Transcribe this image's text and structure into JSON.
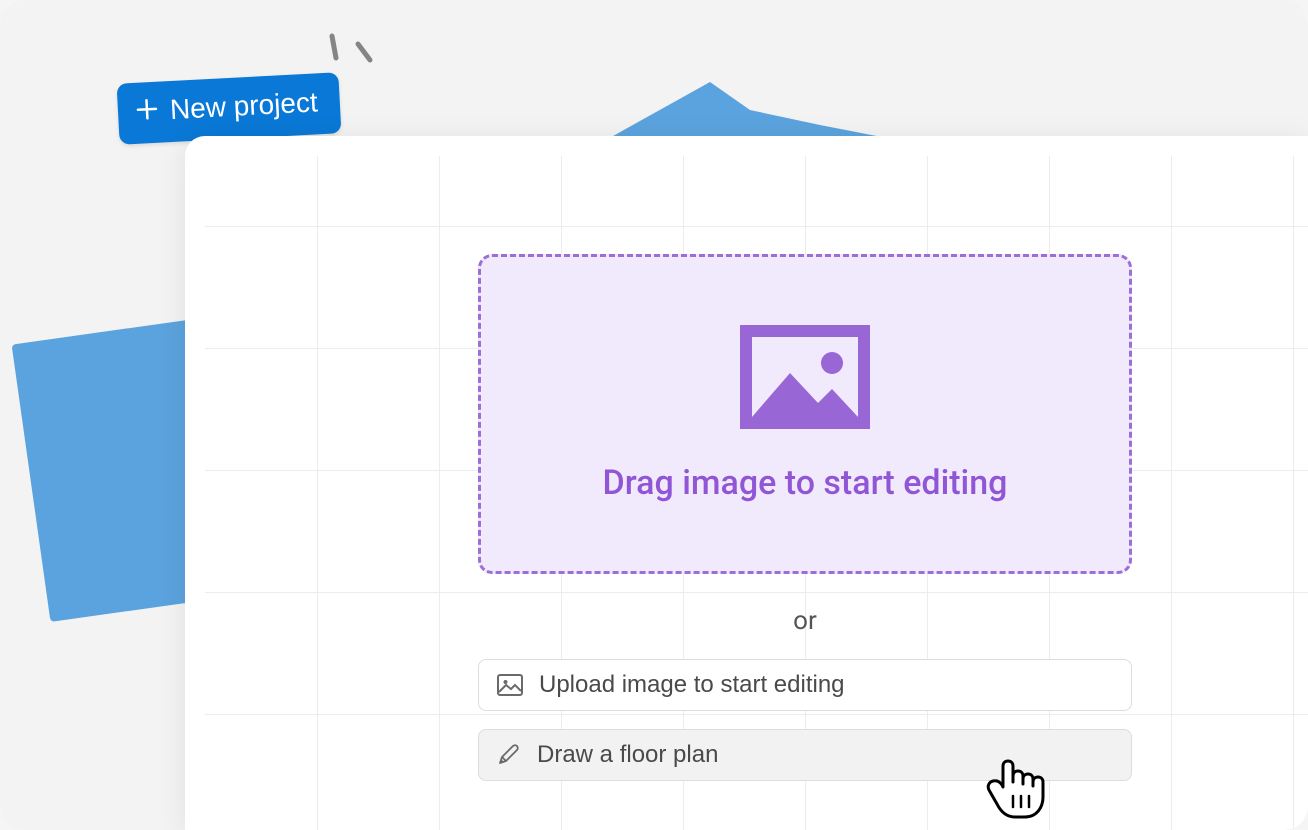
{
  "new_project_button": {
    "label": "New project"
  },
  "dropzone": {
    "prompt": "Drag image to start editing"
  },
  "separator": {
    "label": "or"
  },
  "upload_button": {
    "label": "Upload image to start editing"
  },
  "draw_button": {
    "label": "Draw a floor plan"
  },
  "colors": {
    "primary_blue": "#0a78d6",
    "accent_purple": "#9156d6",
    "dropzone_bg": "#f1eafc",
    "shape_blue": "#5ba3de"
  }
}
